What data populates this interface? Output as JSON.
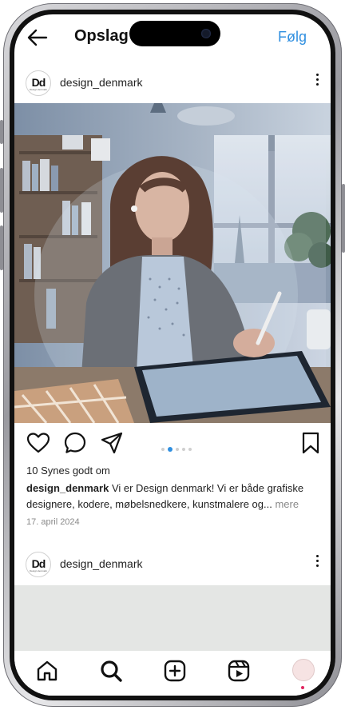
{
  "header": {
    "title": "Opslag",
    "follow_label": "Følg"
  },
  "post1": {
    "username": "design_denmark",
    "avatar_text": "Dd",
    "avatar_subtext": "Design denmark",
    "likes": "10 Synes godt om",
    "caption_user": "design_denmark",
    "caption_line1": " Vi er Design denmark! Vi er både  grafiske",
    "caption_line2": "designere, kodere, møbelsnedkere, kunstmalere og...",
    "more_label": " mere",
    "date": "17. april 2024",
    "carousel": {
      "pages": 5,
      "active_index": 1
    }
  },
  "post2": {
    "username": "design_denmark",
    "avatar_text": "Dd",
    "avatar_subtext": "Design denmark"
  },
  "icons": {
    "back": "arrow-left-icon",
    "more": "more-vertical-icon",
    "like": "heart-icon",
    "comment": "comment-icon",
    "share": "send-icon",
    "save": "bookmark-icon",
    "home": "home-icon",
    "search": "search-icon",
    "create": "plus-square-icon",
    "reels": "reels-icon",
    "profile": "profile-avatar"
  },
  "colors": {
    "accent": "#2f8fe0",
    "notification_dot": "#e0245e"
  }
}
